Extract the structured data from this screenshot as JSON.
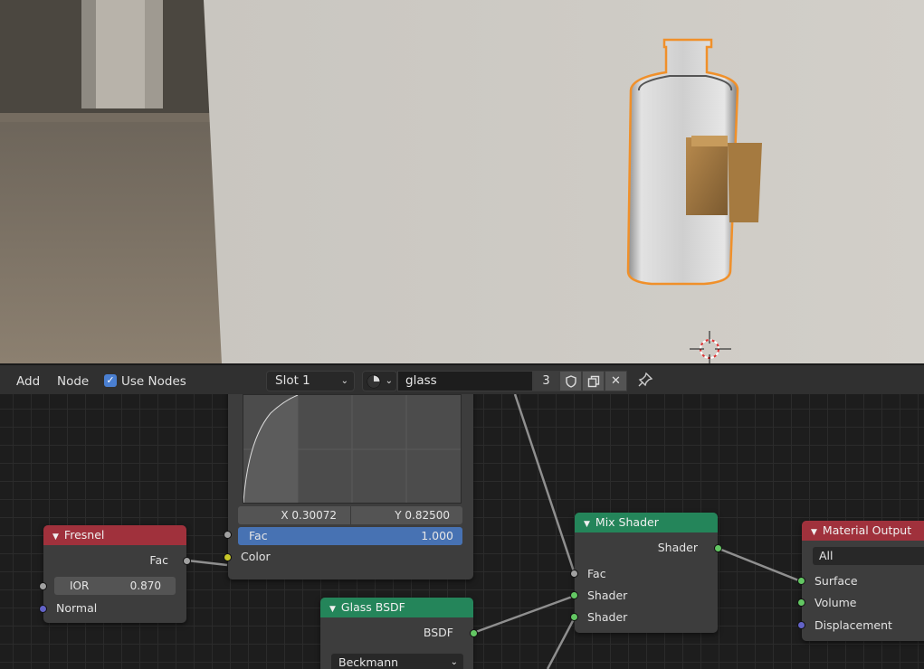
{
  "header": {
    "add_label": "Add",
    "node_label": "Node",
    "use_nodes_label": "Use Nodes",
    "use_nodes_checked": true,
    "slot_value": "Slot 1",
    "material_name": "glass",
    "user_count": "3"
  },
  "nodes": {
    "curve": {
      "x_readout": "X 0.30072",
      "y_readout": "Y 0.82500",
      "fac_label": "Fac",
      "fac_value": "1.000",
      "color_label": "Color"
    },
    "fresnel": {
      "title": "Fresnel",
      "fac_label": "Fac",
      "ior_label": "IOR",
      "ior_value": "0.870",
      "normal_label": "Normal"
    },
    "glass": {
      "title": "Glass BSDF",
      "bsdf_label": "BSDF",
      "distribution": "Beckmann"
    },
    "mix": {
      "title": "Mix Shader",
      "shader_out_label": "Shader",
      "fac_label": "Fac",
      "shader1_label": "Shader",
      "shader2_label": "Shader"
    },
    "output": {
      "title": "Material Output",
      "target": "All",
      "surface_label": "Surface",
      "volume_label": "Volume",
      "displacement_label": "Displacement"
    }
  },
  "colors": {
    "shader_node_header": "#24855a",
    "input_node_header": "#a0313c",
    "selection_outline": "#f0902a",
    "active_slider": "#4772b3"
  }
}
